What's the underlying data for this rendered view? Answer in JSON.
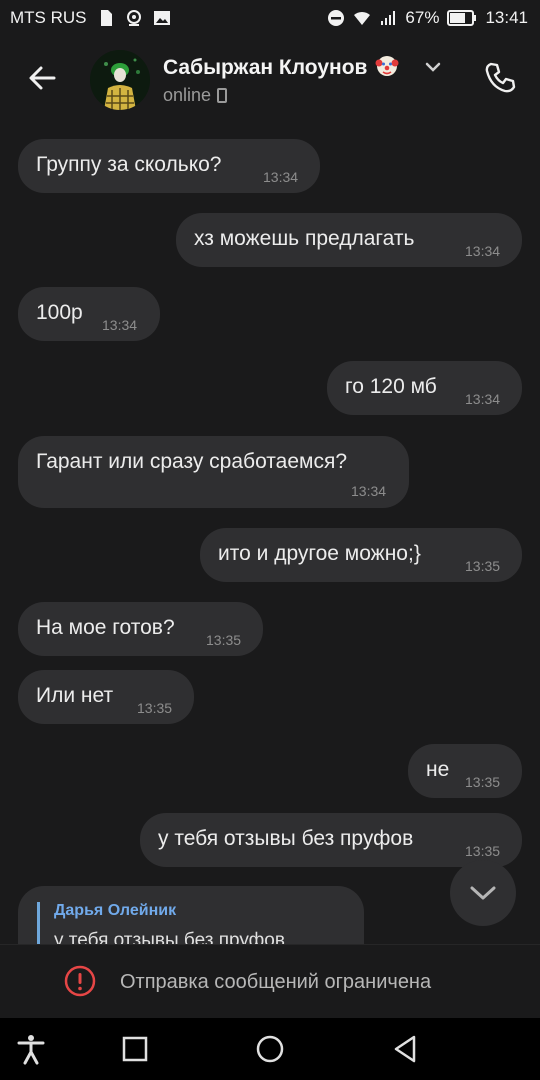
{
  "statusbar": {
    "carrier": "MTS RUS",
    "battery": "67%",
    "time": "13:41"
  },
  "header": {
    "name": "Сабыржан Клоунов",
    "status": "online"
  },
  "messages": [
    {
      "side": "in",
      "text": "Группу за сколько?",
      "time": "13:34"
    },
    {
      "side": "out",
      "text": "хз можешь предлагать",
      "time": "13:34"
    },
    {
      "side": "in",
      "text": "100р",
      "time": "13:34"
    },
    {
      "side": "out",
      "text": "го 120 мб",
      "time": "13:34"
    },
    {
      "side": "in",
      "text": "Гарант или сразу сработаемся?",
      "time": "13:34"
    },
    {
      "side": "out",
      "text": "ито и другое можно;}",
      "time": "13:35"
    },
    {
      "side": "in",
      "text": "На мое готов?",
      "time": "13:35"
    },
    {
      "side": "in",
      "text": "Или нет",
      "time": "13:35"
    },
    {
      "side": "out",
      "text": "не",
      "time": "13:35"
    },
    {
      "side": "out",
      "text": "у тебя отзывы без пруфов",
      "time": "13:35"
    }
  ],
  "reply": {
    "author": "Дарья Олейник",
    "quote": "у тебя отзывы без пруфов"
  },
  "restricted": {
    "label": "Отправка сообщений ограничена"
  },
  "colors": {
    "bubble": "#2f2f31",
    "background": "#1a1a1b",
    "accent": "#71aaeb",
    "warning": "#e64646"
  }
}
